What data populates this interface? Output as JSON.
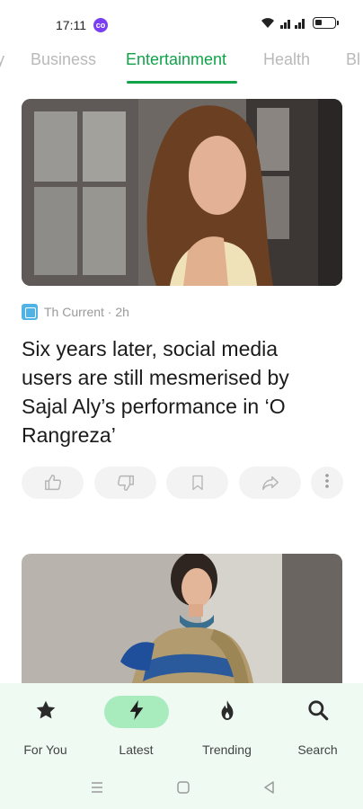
{
  "status_bar": {
    "time": "17:11",
    "badge": "co",
    "icons": [
      "wifi-icon",
      "signal-icon",
      "battery-icon"
    ]
  },
  "tabs": [
    {
      "label": "y",
      "active": false
    },
    {
      "label": "Business",
      "active": false
    },
    {
      "label": "Entertainment",
      "active": true
    },
    {
      "label": "Health",
      "active": false
    },
    {
      "label": "Bl",
      "active": false
    }
  ],
  "article": {
    "image_desc_icon": "photo",
    "source": "Th Current · 2h",
    "headline": "Six years later, social media users are still mesmerised by Sajal Aly’s performance in ‘O Rangreza’",
    "actions": [
      "thumbs-up-icon",
      "thumbs-down-icon",
      "bookmark-icon",
      "share-icon",
      "more-vert-icon"
    ]
  },
  "bottom_nav": [
    {
      "label": "For You",
      "icon": "star-icon",
      "active": false
    },
    {
      "label": "Latest",
      "icon": "bolt-icon",
      "active": true
    },
    {
      "label": "Trending",
      "icon": "flame-icon",
      "active": false
    },
    {
      "label": "Search",
      "icon": "search-icon",
      "active": false
    }
  ],
  "colors": {
    "accent": "#12a34a",
    "nav_background": "#eefaf2",
    "nav_active_pill": "#a8ecbe"
  }
}
